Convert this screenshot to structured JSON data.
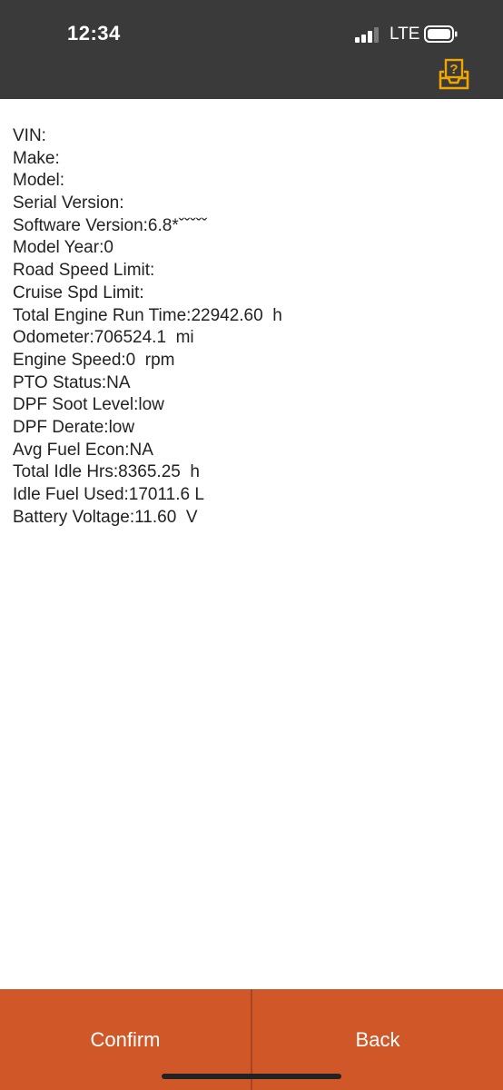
{
  "status_bar": {
    "time": "12:34",
    "network": "LTE",
    "background_color": "#3a3a3a"
  },
  "header": {
    "help_icon": "help-question-icon",
    "help_icon_color": "#f0a500"
  },
  "vehicle_info": {
    "lines": [
      "VIN:",
      "Make:",
      "Model:",
      "Serial Version:",
      "Software Version:6.8*ˇˇˇˇˇ",
      "Model Year:0",
      "Road Speed Limit:",
      "Cruise Spd Limit:",
      "Total Engine Run Time:22942.60  h",
      "Odometer:706524.1  mi",
      "Engine Speed:0  rpm",
      "PTO Status:NA",
      "DPF Soot Level:low",
      "DPF Derate:low",
      "Avg Fuel Econ:NA",
      "Total Idle Hrs:8365.25  h",
      "Idle Fuel Used:17011.6 L",
      "Battery Voltage:11.60  V"
    ]
  },
  "footer": {
    "confirm_label": "Confirm",
    "back_label": "Back",
    "background_color": "#d05728"
  }
}
